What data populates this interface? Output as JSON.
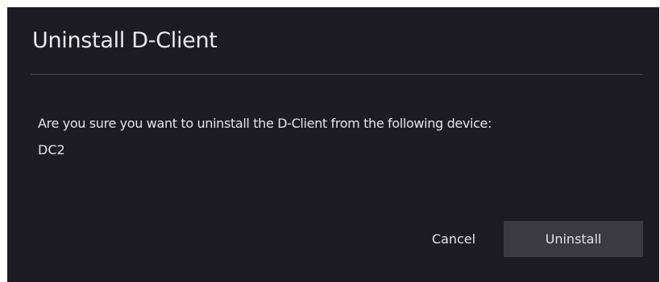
{
  "dialog": {
    "title": "Uninstall D-Client",
    "message": "Are you sure you want to uninstall the D-Client from the following device:",
    "device_name": "DC2",
    "cancel_label": "Cancel",
    "confirm_label": "Uninstall"
  },
  "colors": {
    "dialog_background": "#1e1c23",
    "primary_button_background": "#3b3a42",
    "text": "#e2e2e6",
    "divider": "#4a4850"
  }
}
